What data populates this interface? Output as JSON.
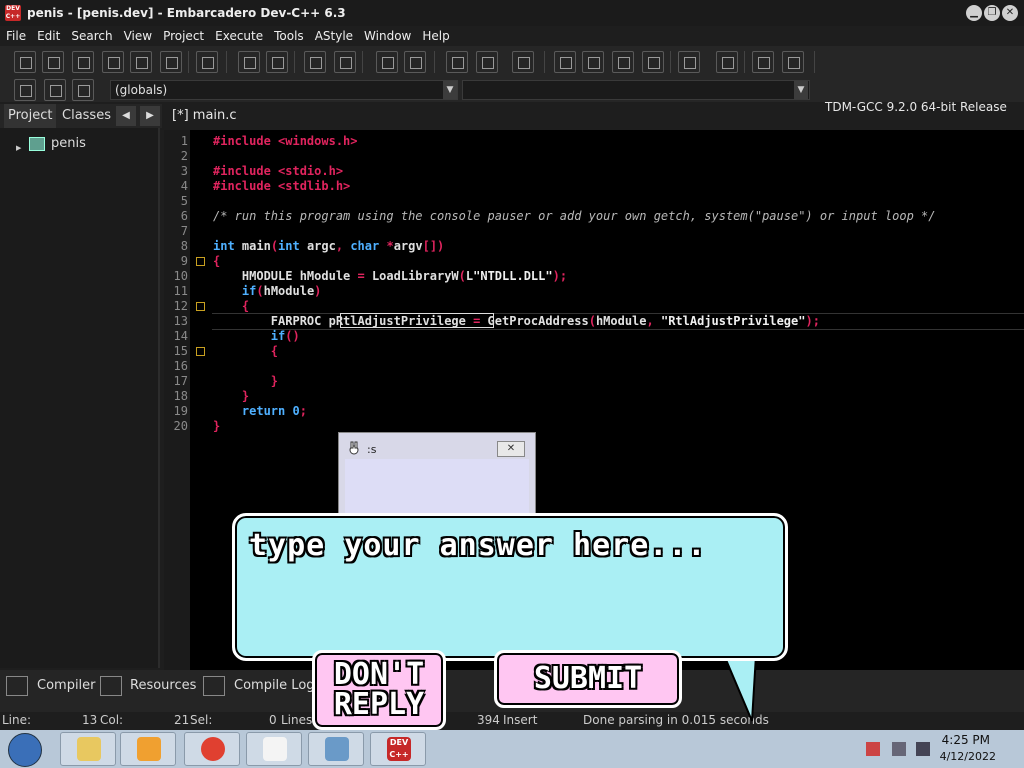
{
  "window": {
    "title": "penis - [penis.dev] - Embarcadero Dev-C++ 6.3",
    "app_icon_text": "DEV C++"
  },
  "menu": [
    "File",
    "Edit",
    "Search",
    "View",
    "Project",
    "Execute",
    "Tools",
    "AStyle",
    "Window",
    "Help"
  ],
  "toolbar": {
    "compiler": "TDM-GCC 9.2.0 64-bit Release",
    "globals_combo": "(globals)"
  },
  "left_panel": {
    "tabs": [
      "Project",
      "Classes"
    ],
    "tree_root": "penis"
  },
  "editor": {
    "tab_label": "[*] main.c",
    "tab_close": "✕",
    "line_numbers": [
      "1",
      "2",
      "3",
      "4",
      "5",
      "6",
      "7",
      "8",
      "9",
      "10",
      "11",
      "12",
      "13",
      "14",
      "15",
      "16",
      "17",
      "18",
      "19",
      "20"
    ],
    "highlighted_word": "pRtlAdjustPrivilege"
  },
  "bottom_tabs": [
    "Compiler",
    "Resources",
    "Compile Log"
  ],
  "status": {
    "line_label": "Line:",
    "line_value": "13",
    "col_label": "Col:",
    "col_value": "21",
    "sel_label": "Sel:",
    "sel_value": "0",
    "lines_label": "Lines:",
    "lines_value": "394",
    "mode": "Insert",
    "message": "Done parsing in 0.015 seconds"
  },
  "taskbar": {
    "time": "4:25 PM",
    "date": "4/12/2022",
    "devcpp_label": "DEV C++"
  },
  "popup": {
    "title": ":s",
    "close": "✕"
  },
  "dialog": {
    "prompt": "type your answer here...",
    "dont_reply": "DON'T REPLY",
    "submit": "SUBMIT"
  },
  "colors": {
    "bubble": "#aaeff4",
    "buttons": "#ffc6f2",
    "keyword": "#4fb0ff",
    "preprocessor": "#e0245e"
  }
}
